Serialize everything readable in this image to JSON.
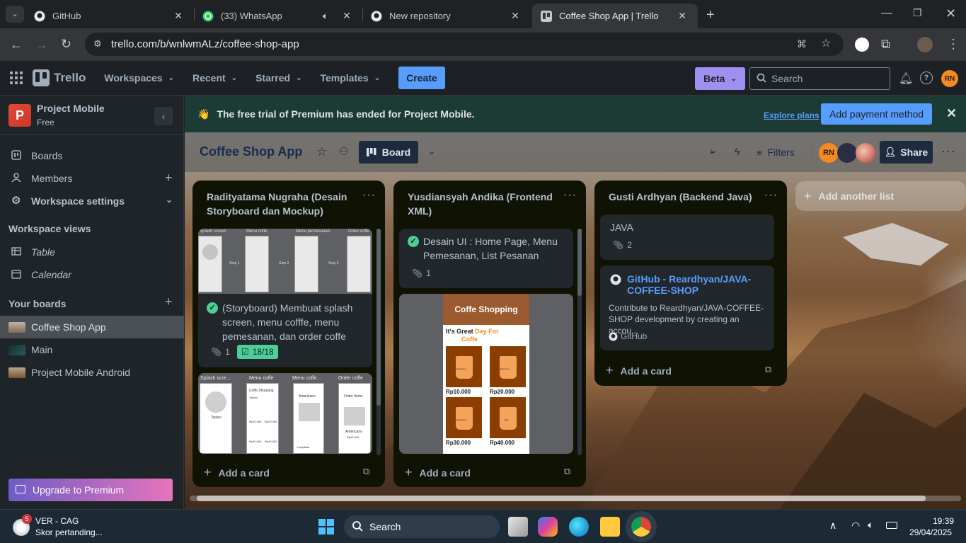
{
  "browser": {
    "tabs": [
      {
        "title": "GitHub",
        "icon": "github-icon"
      },
      {
        "title": "(33) WhatsApp",
        "icon": "whatsapp-icon"
      },
      {
        "title": "New repository",
        "icon": "github-icon"
      },
      {
        "title": "Coffee Shop App | Trello",
        "icon": "trello-icon",
        "active": true
      }
    ],
    "url": "trello.com/b/wnlwmALz/coffee-shop-app"
  },
  "header": {
    "logo_text": "Trello",
    "nav": [
      "Workspaces",
      "Recent",
      "Starred",
      "Templates"
    ],
    "create_label": "Create",
    "beta_label": "Beta",
    "search_placeholder": "Search",
    "avatar_initials": "RN"
  },
  "sidebar": {
    "workspace_initial": "P",
    "workspace_name": "Project Mobile",
    "workspace_plan": "Free",
    "items": [
      "Boards",
      "Members",
      "Workspace settings"
    ],
    "views_heading": "Workspace views",
    "views": [
      "Table",
      "Calendar"
    ],
    "boards_heading": "Your boards",
    "boards": [
      "Coffee Shop App",
      "Main",
      "Project Mobile Android"
    ],
    "upgrade_label": "Upgrade to Premium"
  },
  "banner": {
    "emoji": "👋",
    "text": "The free trial of Premium has ended for Project Mobile.",
    "explore_label": "Explore plans",
    "payment_label": "Add payment method"
  },
  "board": {
    "title": "Coffee Shop App",
    "view_label": "Board",
    "filters_label": "Filters",
    "share_label": "Share",
    "member_initials": "RN"
  },
  "lists": [
    {
      "title": "Radityatama Nugraha (Desain Storyboard dan Mockup)",
      "cards": [
        {
          "text": "(Storyboard) Membuat splash screen, menu cofffe, menu pemesanan, dan order coffe",
          "attachments": "1",
          "checklist": "18/18",
          "cover_labels": [
            "Splash screen",
            "Menu coffe",
            "Menu pemesanan",
            "Order coffe",
            "Step 1",
            "Step 2",
            "Step 3"
          ]
        },
        {
          "cover_labels": [
            "Splash scre...",
            "Menu coffe",
            "Menu coffe...",
            "Order coffe",
            "Topleo",
            "Coffe Shopping",
            "Americano",
            "Order Items",
            "Americano",
            "Rp40.000",
            "Topleo",
            "Rp10.000",
            "Rp20.000",
            "Rp30.000",
            "Rp40.000",
            "Lanjutkan"
          ]
        }
      ],
      "add_label": "Add a card"
    },
    {
      "title": "Yusdiansyah Andika (Frontend XML)",
      "cards": [
        {
          "text": "Desain UI : Home Page, Menu Pemesanan, List Pesanan",
          "attachments": "1"
        },
        {
          "mock_title": "Coffe Shopping",
          "mock_tagline_1": "It's Great",
          "mock_tagline_2": "Day For",
          "mock_tagline_3": "Coffe",
          "mock_cups": [
            "Americano",
            "Espresso",
            "Cappucino",
            "Latte"
          ],
          "mock_prices": [
            "Rp10.000",
            "Rp20.000",
            "Rp30.000",
            "Rp40.000"
          ]
        }
      ],
      "add_label": "Add a card"
    },
    {
      "title": "Gusti Ardhyan (Backend Java)",
      "cards": [
        {
          "text": "JAVA",
          "attachments": "2"
        },
        {
          "link_title": "GitHub - Reardhyan/JAVA-COFFEE-SHOP",
          "description": "Contribute to Reardhyan/JAVA-COFFEE-SHOP development by creating an accou...",
          "source": "GitHub"
        }
      ],
      "add_label": "Add a card"
    }
  ],
  "add_list_label": "Add another list",
  "taskbar": {
    "notif_count": "5",
    "widget_title": "VER - CAG",
    "widget_sub": "Skor pertanding...",
    "search_label": "Search",
    "time": "19:39",
    "date": "29/04/2025"
  },
  "colors": {
    "accent": "#579dff",
    "beta": "#9f8fef",
    "banner": "#1c3b34",
    "success": "#4bce97",
    "workspace_tile": "#e34935"
  }
}
